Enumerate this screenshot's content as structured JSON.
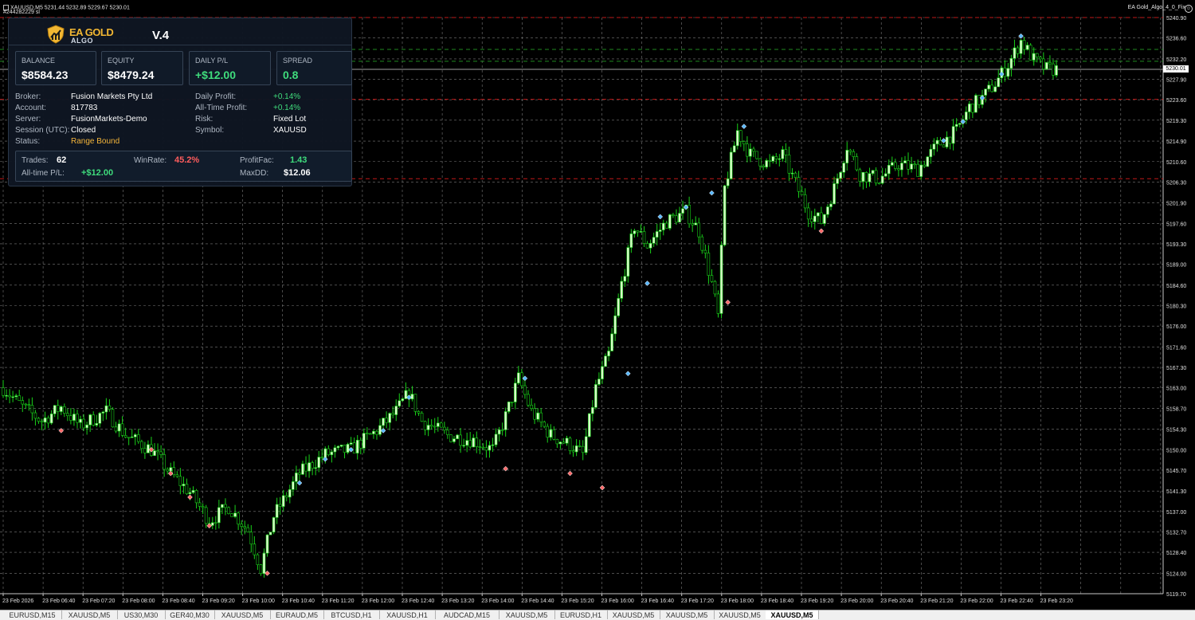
{
  "window": {
    "symbol_header": "XAUUSD,M5  5231.44 5232.89 5229.67 5230.01",
    "sub_header": "#244282229 sl",
    "ea_name": "EA Gold_Algo_4_0_Fix"
  },
  "panel": {
    "logo_line1": "EA GOLD",
    "logo_line2": "ALGO",
    "version": "V.4",
    "stats": [
      {
        "label": "BALANCE",
        "value": "$8584.23"
      },
      {
        "label": "EQUITY",
        "value": "$8479.24"
      },
      {
        "label": "DAILY P/L",
        "value": "+$12.00"
      },
      {
        "label": "SPREAD",
        "value": "0.8"
      }
    ],
    "info_left": [
      {
        "label": "Broker:",
        "value": "Fusion Markets Pty Ltd"
      },
      {
        "label": "Account:",
        "value": "817783"
      },
      {
        "label": "Server:",
        "value": "FusionMarkets-Demo"
      },
      {
        "label": "Session (UTC):",
        "value": "Closed"
      },
      {
        "label": "Status:",
        "value": "Range Bound"
      }
    ],
    "info_right": [
      {
        "label": "Daily Profit:",
        "value": "+0.14%"
      },
      {
        "label": "All-Time Profit:",
        "value": "+0.14%"
      },
      {
        "label": "Risk:",
        "value": "Fixed Lot"
      },
      {
        "label": "Symbol:",
        "value": "XAUUSD"
      }
    ],
    "trades": {
      "trades_label": "Trades:",
      "trades_value": "62",
      "winrate_label": "WinRate:",
      "winrate_value": "45.2%",
      "pf_label": "ProfitFac:",
      "pf_value": "1.43",
      "allpl_label": "All-time P/L:",
      "allpl_value": "+$12.00",
      "maxdd_label": "MaxDD:",
      "maxdd_value": "$12.06"
    },
    "colors": {
      "gold": "#f2b733",
      "green": "#3fdc7c",
      "red": "#ff5d5d",
      "panel_bg": "#0e1622"
    }
  },
  "price_axis": {
    "labels": [
      "5240.90",
      "5236.60",
      "5232.20",
      "5227.90",
      "5223.60",
      "5219.30",
      "5214.90",
      "5210.60",
      "5206.30",
      "5201.90",
      "5197.60",
      "5193.30",
      "5189.00",
      "5184.60",
      "5180.30",
      "5176.00",
      "5171.60",
      "5167.30",
      "5163.00",
      "5158.70",
      "5154.30",
      "5150.00",
      "5145.70",
      "5141.30",
      "5137.00",
      "5132.70",
      "5128.40",
      "5124.00",
      "5119.70"
    ],
    "current_price": "5230.01"
  },
  "time_axis": {
    "labels": [
      "23 Feb 2026",
      "23 Feb 06:40",
      "23 Feb 07:20",
      "23 Feb 08:00",
      "23 Feb 08:40",
      "23 Feb 09:20",
      "23 Feb 10:00",
      "23 Feb 10:40",
      "23 Feb 11:20",
      "23 Feb 12:00",
      "23 Feb 12:40",
      "23 Feb 13:20",
      "23 Feb 14:00",
      "23 Feb 14:40",
      "23 Feb 15:20",
      "23 Feb 16:00",
      "23 Feb 16:40",
      "23 Feb 17:20",
      "23 Feb 18:00",
      "23 Feb 18:40",
      "23 Feb 19:20",
      "23 Feb 20:00",
      "23 Feb 20:40",
      "23 Feb 21:20",
      "23 Feb 22:00",
      "23 Feb 22:40",
      "23 Feb 23:20"
    ]
  },
  "chart_data": {
    "type": "candlestick",
    "symbol": "XAUUSD",
    "timeframe": "M5",
    "ylim": [
      5119.7,
      5240.9
    ],
    "grid": true,
    "levels": [
      {
        "price": 5240.9,
        "style": "dashed",
        "color": "#c01818"
      },
      {
        "price": 5234.2,
        "style": "dashed",
        "color": "#1f8a1f"
      },
      {
        "price": 5231.7,
        "style": "dashed",
        "color": "#1f8a1f"
      },
      {
        "price": 5230.01,
        "style": "solid",
        "color": "#a0a0a0"
      },
      {
        "price": 5223.7,
        "style": "dashed",
        "color": "#c01818"
      },
      {
        "price": 5207.0,
        "style": "dashed",
        "color": "#c01818"
      }
    ],
    "path_points": [
      {
        "t": 0,
        "p": 5163
      },
      {
        "t": 6,
        "p": 5159
      },
      {
        "t": 12,
        "p": 5156
      },
      {
        "t": 18,
        "p": 5159
      },
      {
        "t": 24,
        "p": 5155
      },
      {
        "t": 32,
        "p": 5158
      },
      {
        "t": 38,
        "p": 5153
      },
      {
        "t": 46,
        "p": 5150
      },
      {
        "t": 52,
        "p": 5145
      },
      {
        "t": 58,
        "p": 5141
      },
      {
        "t": 64,
        "p": 5135
      },
      {
        "t": 70,
        "p": 5138
      },
      {
        "t": 76,
        "p": 5133
      },
      {
        "t": 80,
        "p": 5125
      },
      {
        "t": 84,
        "p": 5136
      },
      {
        "t": 92,
        "p": 5145
      },
      {
        "t": 100,
        "p": 5149
      },
      {
        "t": 108,
        "p": 5150
      },
      {
        "t": 116,
        "p": 5154
      },
      {
        "t": 122,
        "p": 5158
      },
      {
        "t": 126,
        "p": 5162
      },
      {
        "t": 130,
        "p": 5156
      },
      {
        "t": 138,
        "p": 5153
      },
      {
        "t": 146,
        "p": 5152
      },
      {
        "t": 152,
        "p": 5150
      },
      {
        "t": 156,
        "p": 5157
      },
      {
        "t": 160,
        "p": 5165
      },
      {
        "t": 164,
        "p": 5158
      },
      {
        "t": 170,
        "p": 5153
      },
      {
        "t": 176,
        "p": 5151
      },
      {
        "t": 180,
        "p": 5149
      },
      {
        "t": 184,
        "p": 5163
      },
      {
        "t": 188,
        "p": 5170
      },
      {
        "t": 192,
        "p": 5185
      },
      {
        "t": 196,
        "p": 5197
      },
      {
        "t": 200,
        "p": 5193
      },
      {
        "t": 206,
        "p": 5198
      },
      {
        "t": 212,
        "p": 5200
      },
      {
        "t": 216,
        "p": 5196
      },
      {
        "t": 220,
        "p": 5185
      },
      {
        "t": 222,
        "p": 5178
      },
      {
        "t": 224,
        "p": 5205
      },
      {
        "t": 228,
        "p": 5217
      },
      {
        "t": 232,
        "p": 5212
      },
      {
        "t": 238,
        "p": 5210
      },
      {
        "t": 242,
        "p": 5212
      },
      {
        "t": 246,
        "p": 5206
      },
      {
        "t": 250,
        "p": 5200
      },
      {
        "t": 254,
        "p": 5198
      },
      {
        "t": 258,
        "p": 5205
      },
      {
        "t": 262,
        "p": 5214
      },
      {
        "t": 266,
        "p": 5208
      },
      {
        "t": 272,
        "p": 5207
      },
      {
        "t": 278,
        "p": 5210
      },
      {
        "t": 284,
        "p": 5209
      },
      {
        "t": 290,
        "p": 5214
      },
      {
        "t": 296,
        "p": 5217
      },
      {
        "t": 300,
        "p": 5222
      },
      {
        "t": 304,
        "p": 5224
      },
      {
        "t": 308,
        "p": 5227
      },
      {
        "t": 312,
        "p": 5231
      },
      {
        "t": 316,
        "p": 5236
      },
      {
        "t": 320,
        "p": 5232
      },
      {
        "t": 324,
        "p": 5230
      },
      {
        "t": 327,
        "p": 5230.01
      }
    ],
    "markers": [
      {
        "t": 18,
        "p": 5154,
        "color": "#ff6a6a"
      },
      {
        "t": 46,
        "p": 5150,
        "color": "#ff6a6a"
      },
      {
        "t": 52,
        "p": 5145,
        "color": "#ff6a6a"
      },
      {
        "t": 58,
        "p": 5140,
        "color": "#ff6a6a"
      },
      {
        "t": 64,
        "p": 5134,
        "color": "#ff6a6a"
      },
      {
        "t": 82,
        "p": 5124,
        "color": "#ff6a6a"
      },
      {
        "t": 92,
        "p": 5143,
        "color": "#5ab8ff"
      },
      {
        "t": 100,
        "p": 5148,
        "color": "#5ab8ff"
      },
      {
        "t": 108,
        "p": 5150,
        "color": "#5ab8ff"
      },
      {
        "t": 118,
        "p": 5154,
        "color": "#5ab8ff"
      },
      {
        "t": 126,
        "p": 5161,
        "color": "#5ab8ff"
      },
      {
        "t": 156,
        "p": 5146,
        "color": "#ff6a6a"
      },
      {
        "t": 162,
        "p": 5165,
        "color": "#5ab8ff"
      },
      {
        "t": 176,
        "p": 5145,
        "color": "#ff6a6a"
      },
      {
        "t": 186,
        "p": 5142,
        "color": "#ff6a6a"
      },
      {
        "t": 194,
        "p": 5166,
        "color": "#5ab8ff"
      },
      {
        "t": 200,
        "p": 5185,
        "color": "#5ab8ff"
      },
      {
        "t": 204,
        "p": 5199,
        "color": "#5ab8ff"
      },
      {
        "t": 212,
        "p": 5201,
        "color": "#5ab8ff"
      },
      {
        "t": 220,
        "p": 5204,
        "color": "#5ab8ff"
      },
      {
        "t": 225,
        "p": 5181,
        "color": "#ff6a6a"
      },
      {
        "t": 230,
        "p": 5218,
        "color": "#5ab8ff"
      },
      {
        "t": 254,
        "p": 5196,
        "color": "#ff6a6a"
      },
      {
        "t": 292,
        "p": 5215,
        "color": "#5ab8ff"
      },
      {
        "t": 298,
        "p": 5219,
        "color": "#5ab8ff"
      },
      {
        "t": 304,
        "p": 5224,
        "color": "#5ab8ff"
      },
      {
        "t": 310,
        "p": 5229,
        "color": "#5ab8ff"
      },
      {
        "t": 316,
        "p": 5237,
        "color": "#5ab8ff"
      }
    ],
    "bull_color": "#d8ffc8",
    "bear_color": "#000000",
    "wick_color": "#19d219",
    "grid_color": "#7a7a7a"
  },
  "tabs": [
    {
      "label": "EURUSD,M15"
    },
    {
      "label": "XAUUSD,M5"
    },
    {
      "label": "US30,M30"
    },
    {
      "label": "GER40,M30"
    },
    {
      "label": "XAUUSD,M5"
    },
    {
      "label": "EURAUD,M5"
    },
    {
      "label": "BTCUSD,H1"
    },
    {
      "label": "XAUUSD,H1"
    },
    {
      "label": "AUDCAD,M15"
    },
    {
      "label": "XAUUSD,M5"
    },
    {
      "label": "EURUSD,H1"
    },
    {
      "label": "XAUUSD,M5"
    },
    {
      "label": "XAUUSD,M5"
    },
    {
      "label": "XAUUSD,M5"
    },
    {
      "label": "XAUUSD,M5",
      "active": true
    }
  ]
}
